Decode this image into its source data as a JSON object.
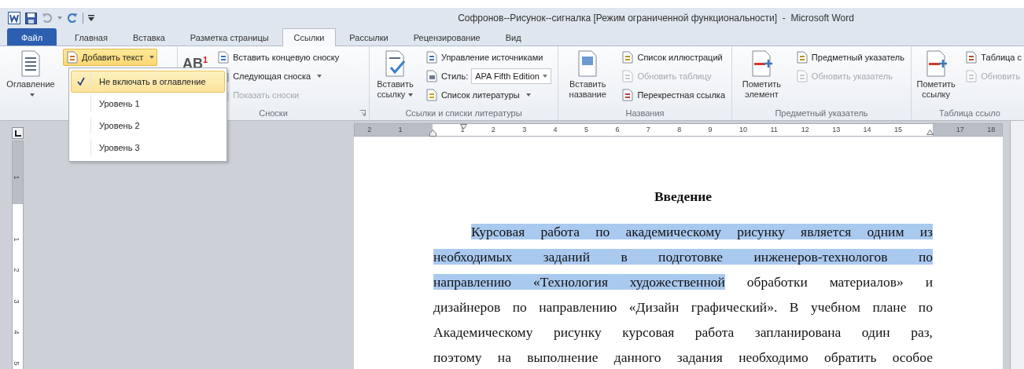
{
  "title_bar": {
    "title": "Софронов--Рисунок--сигналка [Режим ограниченной функциональности]  -  Microsoft Word"
  },
  "tabs": [
    {
      "label": "Файл",
      "kind": "file",
      "selected": false
    },
    {
      "label": "Главная",
      "kind": "tab",
      "selected": false
    },
    {
      "label": "Вставка",
      "kind": "tab",
      "selected": false
    },
    {
      "label": "Разметка страницы",
      "kind": "tab",
      "selected": false
    },
    {
      "label": "Ссылки",
      "kind": "tab",
      "selected": true
    },
    {
      "label": "Рассылки",
      "kind": "tab",
      "selected": false
    },
    {
      "label": "Рецензирование",
      "kind": "tab",
      "selected": false
    },
    {
      "label": "Вид",
      "kind": "tab",
      "selected": false
    }
  ],
  "ribbon": {
    "groups": [
      {
        "kind": "toc",
        "big": {
          "label": "Оглавление",
          "dropdown": true
        },
        "small": [
          {
            "label": "Добавить текст",
            "dropdown": true,
            "open": true,
            "disabled": false
          }
        ]
      },
      {
        "kind": "footnotes",
        "label": "Сноски",
        "launcher": true,
        "big": {
          "icon_text": "AB$^{1}$"
        },
        "small": [
          {
            "label": "Вставить концевую сноску",
            "dropdown": false,
            "open": false,
            "disabled": false
          },
          {
            "label": "Следующая сноска",
            "dropdown": true,
            "open": false,
            "disabled": false
          },
          {
            "label": "Показать сноски",
            "dropdown": false,
            "open": false,
            "disabled": true
          }
        ]
      },
      {
        "kind": "citations",
        "label": "Ссылки и списки литературы",
        "big": {
          "label": "Вставить ссылку",
          "dropdown": true
        },
        "small": [
          {
            "label": "Управление источниками",
            "dropdown": false,
            "open": false,
            "disabled": false
          },
          {
            "kind": "style",
            "label": "Стиль:",
            "value": "APA Fifth Edition"
          },
          {
            "label": "Список литературы",
            "dropdown": true,
            "open": false,
            "disabled": false
          }
        ]
      },
      {
        "kind": "captions",
        "label": "Названия",
        "big": {
          "label": "Вставить название",
          "dropdown": false
        },
        "small": [
          {
            "label": "Список иллюстраций",
            "dropdown": false,
            "open": false,
            "disabled": false
          },
          {
            "label": "Обновить таблицу",
            "dropdown": false,
            "open": false,
            "disabled": true
          },
          {
            "label": "Перекрестная ссылка",
            "dropdown": false,
            "open": false,
            "disabled": false
          }
        ]
      },
      {
        "kind": "index",
        "label": "Предметный указатель",
        "big": {
          "label": "Пометить элемент",
          "dropdown": false
        },
        "small": [
          {
            "label": "Предметный указатель",
            "dropdown": false,
            "open": false,
            "disabled": false
          },
          {
            "label": "Обновить указатель",
            "dropdown": false,
            "open": false,
            "disabled": true
          }
        ]
      },
      {
        "kind": "authorities",
        "label": "Таблица ссыло",
        "big": {
          "label": "Пометить ссылку",
          "dropdown": false
        },
        "small": [
          {
            "label": "Таблица с",
            "dropdown": false,
            "open": false,
            "disabled": false
          },
          {
            "label": "Обновить",
            "dropdown": false,
            "open": false,
            "disabled": true
          }
        ]
      }
    ]
  },
  "menu": {
    "items": [
      {
        "label": "Не включать в оглавление",
        "checked": true,
        "selected": true
      },
      {
        "label": "Уровень 1",
        "checked": false,
        "selected": false
      },
      {
        "label": "Уровень 2",
        "checked": false,
        "selected": false
      },
      {
        "label": "Уровень 3",
        "checked": false,
        "selected": false
      }
    ]
  },
  "ruler": {
    "labels": [
      "2",
      "1",
      "1",
      "2",
      "3",
      "4",
      "5",
      "6",
      "7",
      "8",
      "9",
      "10",
      "11",
      "12",
      "13",
      "14",
      "15",
      "17",
      "18"
    ]
  },
  "vertical_ruler": {
    "labels": [
      "1",
      "1",
      "2",
      "3",
      "4",
      "5"
    ]
  },
  "document": {
    "heading": "Введение",
    "lines": [
      {
        "indent": true,
        "segments": [
          {
            "text": "Курсовая работа по академическому рисунку является одним из",
            "selected": true
          }
        ]
      },
      {
        "indent": false,
        "segments": [
          {
            "text": "необходимых заданий  в подготовке инженеров-технологов  по",
            "selected": true
          }
        ]
      },
      {
        "indent": false,
        "segments": [
          {
            "text": "направлению «Технология художественной",
            "selected": true
          },
          {
            "text": " обработки материалов» и",
            "selected": false
          }
        ]
      },
      {
        "indent": false,
        "segments": [
          {
            "text": "дизайнеров по направлению «Дизайн графический». В учебном плане по",
            "selected": false
          }
        ]
      },
      {
        "indent": false,
        "segments": [
          {
            "text": "Академическому рисунку курсовая работа запланирована один раз,",
            "selected": false
          }
        ]
      },
      {
        "indent": false,
        "segments": [
          {
            "text": "поэтому на выполнение данного задания необходимо обратить особое",
            "selected": false
          }
        ]
      }
    ]
  }
}
